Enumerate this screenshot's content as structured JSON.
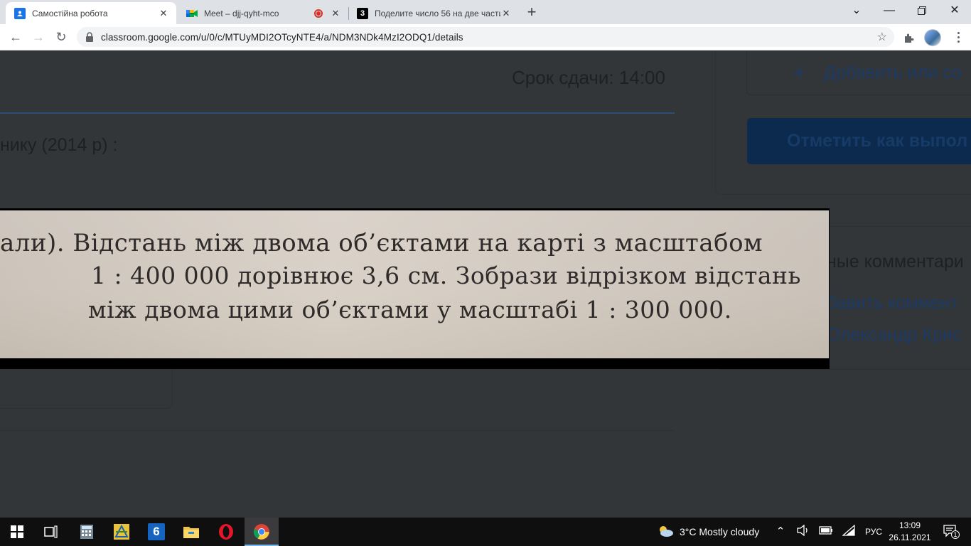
{
  "browser": {
    "tabs": [
      {
        "title": "Самостійна робота",
        "active": true,
        "favicon": "classroom-icon"
      },
      {
        "title": "Meet – djj-qyht-mco",
        "active": false,
        "favicon": "meet-icon",
        "recording": true
      },
      {
        "title": "Поделите число 56 на две части",
        "active": false,
        "favicon": "znanija-icon"
      }
    ],
    "url": "classroom.google.com/u/0/c/MTUyMDI2OTcyNTE4/a/NDM3NDk4MzI2ODQ1/details",
    "new_tab_symbol": "+"
  },
  "assignment": {
    "due": "Срок сдачи: 14:00",
    "subtitle": "нику (2014 р) :",
    "add_or_create": "Добавить или со",
    "mark_done": "Отметить как выпол",
    "private_comments_title": "ные комментари",
    "add_comment": "бавить коммент",
    "commenter": "Олександр Крис"
  },
  "image_viewer": {
    "lines": [
      "али).  Відстань між двома об’єктами на карті з масштабом",
      "1 : 400 000 дорівнює 3,6 см. Зобрази відрізком відстань",
      "між двома цими об’єктами у масштабі 1 : 300 000."
    ]
  },
  "taskbar": {
    "weather": "3°C  Mostly cloudy",
    "language": "РУС",
    "time": "13:09",
    "date": "26.11.2021",
    "notifications": "1",
    "apps": [
      "start-icon",
      "task-view-icon",
      "calculator-icon",
      "geometry-app-icon",
      "six-app-icon",
      "file-explorer-icon",
      "opera-icon",
      "chrome-icon"
    ]
  }
}
